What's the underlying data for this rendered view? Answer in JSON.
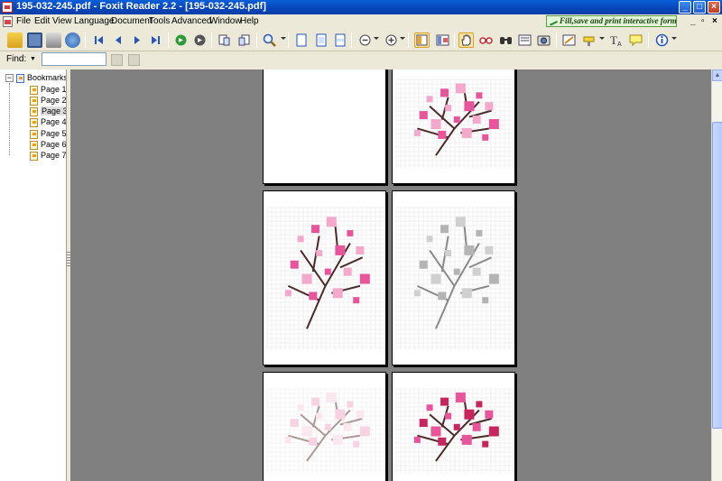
{
  "window": {
    "title": "195-032-245.pdf - Foxit Reader 2.2 - [195-032-245.pdf]",
    "buttons": {
      "minimize": "_",
      "maximize": "□",
      "close": "×"
    },
    "mdi_buttons": {
      "minimize": "_",
      "restore": "▫",
      "close": "×"
    }
  },
  "menu": [
    "File",
    "Edit",
    "View",
    "Language",
    "Document",
    "Tools",
    "Advanced",
    "Window",
    "Help"
  ],
  "promo_text": "Fill,save and print interactive forms!",
  "toolbar_icons": [
    "open-icon",
    "save-icon",
    "print-icon",
    "email-icon",
    "first-page-icon",
    "previous-page-icon",
    "next-page-icon",
    "last-page-icon",
    "go-back-icon",
    "go-forward-icon",
    "rotate-left-icon",
    "rotate-right-icon",
    "zoom-icon",
    "actual-size-icon",
    "fit-page-icon",
    "fit-width-icon",
    "zoom-out-icon",
    "zoom-in-icon",
    "bookmarks-panel-icon",
    "thumbnails-panel-icon",
    "hand-tool-icon",
    "loupe-icon",
    "find-icon",
    "snapshot-icon",
    "typewriter-icon",
    "highlight-icon",
    "text-tool-icon",
    "note-icon",
    "about-icon"
  ],
  "find": {
    "label": "Find:",
    "value": ""
  },
  "bookmarks": {
    "root": "Bookmarks",
    "items": [
      "Page 1",
      "Page 2",
      "Page 3",
      "Page 4",
      "Page 5",
      "Page 6",
      "Page 7"
    ],
    "selected": "Page 3"
  },
  "colors": {
    "pink": "#e8559a",
    "pink_light": "#f4a8cb",
    "stem": "#4a2a2a",
    "magenta": "#c8255e",
    "gray_motif": "#b4b4b4"
  }
}
